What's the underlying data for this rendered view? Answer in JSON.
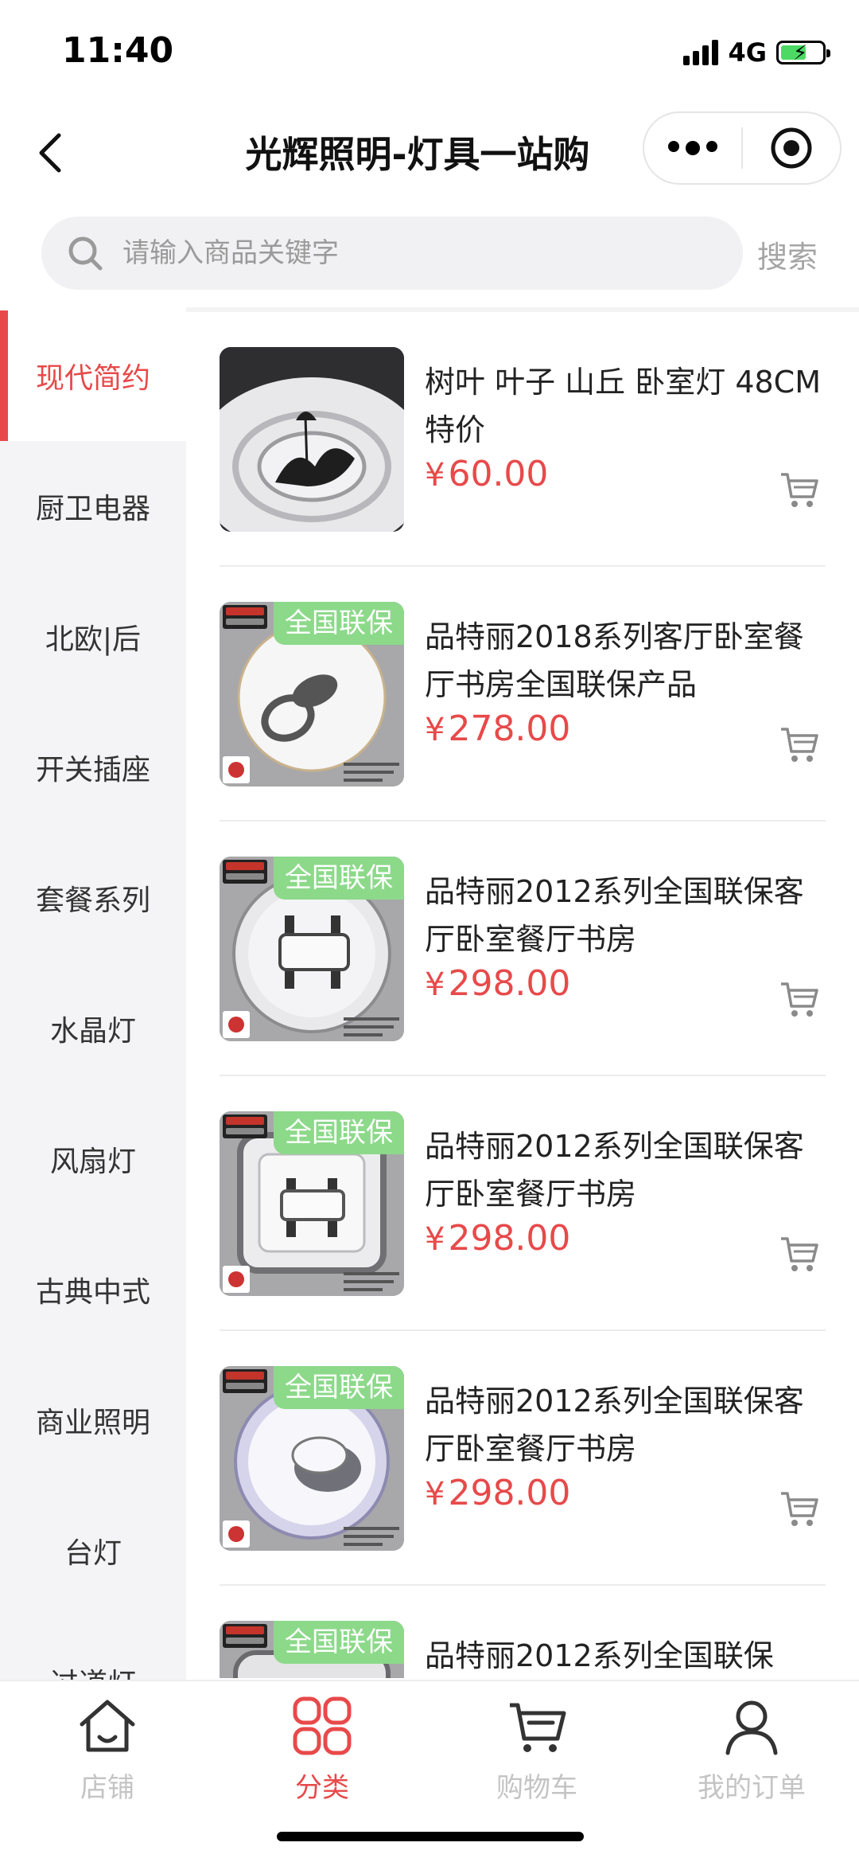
{
  "status_bar": {
    "time": "11:40",
    "network": "4G",
    "battery_level": 0.6
  },
  "nav": {
    "title": "光辉照明-灯具一站购",
    "back_icon": "chevron-left-icon",
    "more_icon": "more-dots-icon",
    "close_icon": "target-circle-icon"
  },
  "search": {
    "placeholder": "请输入商品关键字",
    "value": "",
    "button_label": "搜索",
    "icon": "search-icon"
  },
  "sidebar": {
    "items": [
      {
        "label": "现代简约",
        "active": true
      },
      {
        "label": "厨卫电器",
        "active": false
      },
      {
        "label": "北欧|后",
        "active": false
      },
      {
        "label": "开关插座",
        "active": false
      },
      {
        "label": "套餐系列",
        "active": false
      },
      {
        "label": "水晶灯",
        "active": false
      },
      {
        "label": "风扇灯",
        "active": false
      },
      {
        "label": "古典中式",
        "active": false
      },
      {
        "label": "商业照明",
        "active": false
      },
      {
        "label": "台灯",
        "active": false
      },
      {
        "label": "过道灯",
        "active": false
      }
    ]
  },
  "products": [
    {
      "name": "树叶 叶子 山丘 卧室灯 48CM 特价",
      "currency": "¥",
      "price": "60.00",
      "badge": ""
    },
    {
      "name": "品特丽2018系列客厅卧室餐厅书房全国联保产品",
      "currency": "¥",
      "price": "278.00",
      "badge": "全国联保"
    },
    {
      "name": "品特丽2012系列全国联保客厅卧室餐厅书房",
      "currency": "¥",
      "price": "298.00",
      "badge": "全国联保"
    },
    {
      "name": "品特丽2012系列全国联保客厅卧室餐厅书房",
      "currency": "¥",
      "price": "298.00",
      "badge": "全国联保"
    },
    {
      "name": "品特丽2012系列全国联保客厅卧室餐厅书房",
      "currency": "¥",
      "price": "298.00",
      "badge": "全国联保"
    },
    {
      "name": "品特丽2012系列全国联保",
      "currency": "¥",
      "price": "",
      "badge": "全国联保"
    }
  ],
  "tab_bar": {
    "items": [
      {
        "label": "店铺",
        "icon": "home-icon",
        "active": false
      },
      {
        "label": "分类",
        "icon": "category-grid-icon",
        "active": true
      },
      {
        "label": "购物车",
        "icon": "shopping-cart-icon",
        "active": false
      },
      {
        "label": "我的订单",
        "icon": "user-icon",
        "active": false
      }
    ]
  },
  "colors": {
    "accent": "#e8494a",
    "badge_green": "#8cd98a",
    "sidebar_bg": "#f4f4f6",
    "inactive_text": "#c4c4c4"
  }
}
